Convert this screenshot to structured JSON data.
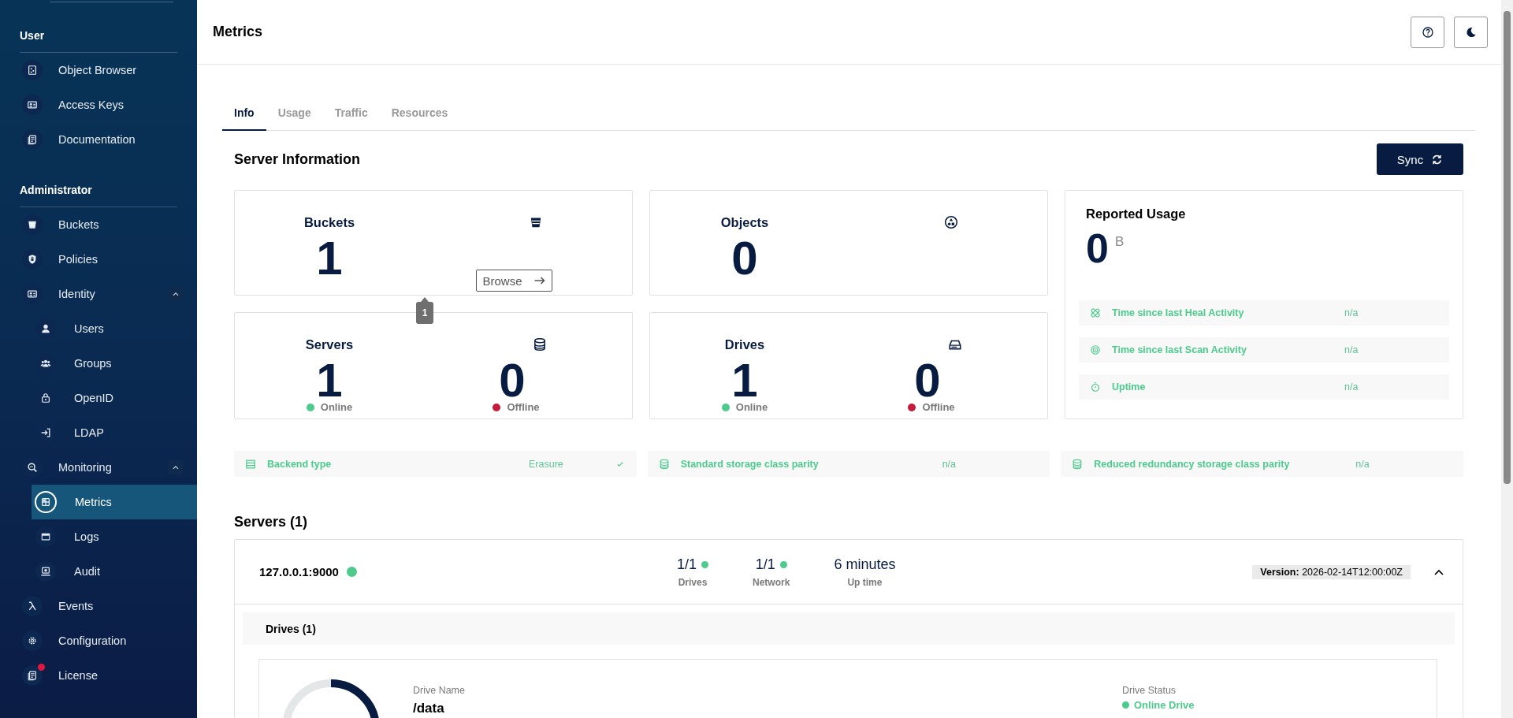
{
  "sidebar": {
    "sections": [
      {
        "title": "User",
        "items": [
          {
            "label": "Object Browser",
            "selected": false,
            "alert": false
          },
          {
            "label": "Access Keys",
            "selected": false,
            "alert": false
          },
          {
            "label": "Documentation",
            "selected": false,
            "alert": false
          }
        ]
      },
      {
        "title": "Administrator",
        "items": [
          {
            "label": "Buckets",
            "selected": false,
            "alert": false
          },
          {
            "label": "Policies",
            "selected": false,
            "alert": false
          },
          {
            "label": "Identity",
            "selected": false,
            "alert": false,
            "expanded": true,
            "children": [
              {
                "label": "Users",
                "selected": false,
                "alert": false
              },
              {
                "label": "Groups",
                "selected": false,
                "alert": false
              },
              {
                "label": "OpenID",
                "selected": false,
                "alert": false
              },
              {
                "label": "LDAP",
                "selected": false,
                "alert": false
              }
            ]
          },
          {
            "label": "Monitoring",
            "selected": false,
            "alert": false,
            "expanded": true,
            "children": [
              {
                "label": "Metrics",
                "selected": true,
                "alert": false
              },
              {
                "label": "Logs",
                "selected": false,
                "alert": false
              },
              {
                "label": "Audit",
                "selected": false,
                "alert": false
              }
            ]
          },
          {
            "label": "Events",
            "selected": false,
            "alert": false
          },
          {
            "label": "Configuration",
            "selected": false,
            "alert": false
          },
          {
            "label": "License",
            "selected": false,
            "alert": true
          }
        ]
      }
    ]
  },
  "header": {
    "title": "Metrics"
  },
  "tabs": [
    {
      "label": "Info",
      "selected": true
    },
    {
      "label": "Usage",
      "selected": false
    },
    {
      "label": "Traffic",
      "selected": false
    },
    {
      "label": "Resources",
      "selected": false
    }
  ],
  "server_info": {
    "title": "Server Information",
    "sync_button": "Sync",
    "cards": [
      {
        "kind": "single",
        "label": "Buckets",
        "value": "1",
        "button": "Browse",
        "tooltip": "1"
      },
      {
        "kind": "single",
        "label": "Objects",
        "value": "0"
      },
      {
        "kind": "split",
        "label": "Servers",
        "online": {
          "value": "1",
          "label": "Online",
          "color": "#4ccb8d"
        },
        "offline": {
          "value": "0",
          "label": "Offline",
          "color": "#c51b3f"
        }
      },
      {
        "kind": "split",
        "label": "Drives",
        "online": {
          "value": "1",
          "label": "Online",
          "color": "#4ccb8d"
        },
        "offline": {
          "value": "0",
          "label": "Offline",
          "color": "#c51b3f"
        }
      }
    ],
    "usage": {
      "title": "Reported Usage",
      "value": "0",
      "unit": "B",
      "rows": [
        {
          "label": "Time since last Heal Activity",
          "value": "n/a"
        },
        {
          "label": "Time since last Scan Activity",
          "value": "n/a"
        },
        {
          "label": "Uptime",
          "value": "n/a"
        }
      ]
    },
    "info_rows": [
      {
        "label": "Backend type",
        "value": "Erasure",
        "verified": true
      },
      {
        "label": "Standard storage class parity",
        "value": "n/a",
        "verified": false
      },
      {
        "label": "Reduced redundancy storage class parity",
        "value": "n/a",
        "verified": false
      }
    ]
  },
  "servers": {
    "title": "Servers (1)",
    "items": [
      {
        "address": "127.0.0.1:9000",
        "color": "#4ccb8d",
        "expanded": true,
        "stats": [
          {
            "value": "1/1",
            "label": "Drives",
            "color": "#4ccb8d"
          },
          {
            "value": "1/1",
            "label": "Network",
            "color": "#4ccb8d"
          }
        ],
        "uptime": {
          "value": "6 minutes",
          "label": "Up time"
        },
        "version": "**Version:** 2026-02-14T12:00:00Z",
        "drives_title": "Drives (1)",
        "drives": [
          {
            "name_label": "Drive Name",
            "name": "/data",
            "status_label": "Drive Status",
            "status": "Online Drive",
            "color": "#4ccb8d"
          }
        ]
      }
    ]
  }
}
